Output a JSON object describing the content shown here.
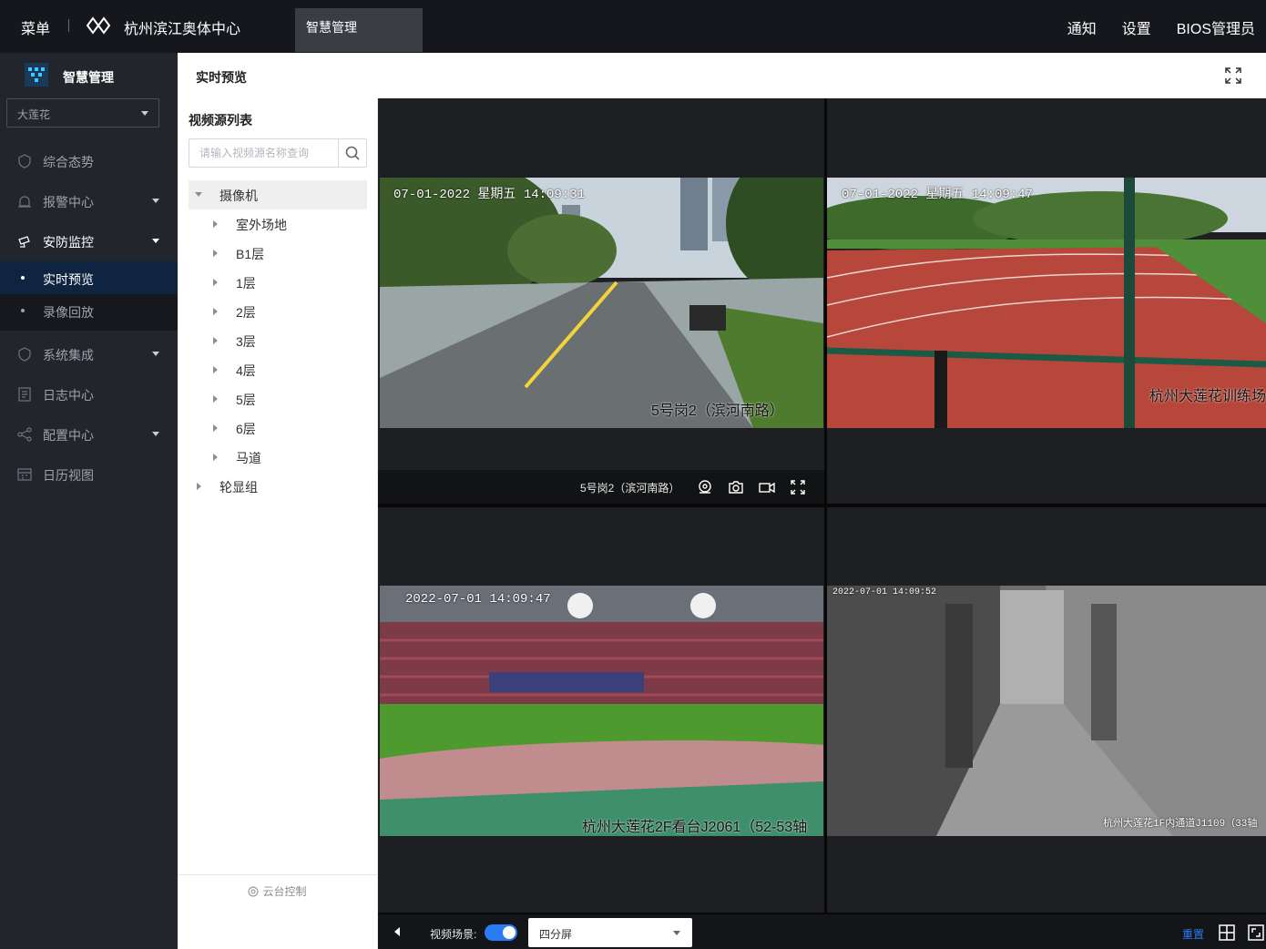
{
  "topbar": {
    "menu": "菜单",
    "app_title": "杭州滨江奥体中心",
    "active_tab": "智慧管理",
    "right": {
      "notify": "通知",
      "settings": "设置",
      "user": "BIOS管理员"
    }
  },
  "sidebar": {
    "title": "智慧管理",
    "venue": "大莲花",
    "items": [
      {
        "label": "综合态势",
        "icon": "shield-icon"
      },
      {
        "label": "报警中心",
        "icon": "alarm-icon"
      },
      {
        "label": "安防监控",
        "icon": "camera-icon"
      },
      {
        "label": "系统集成",
        "icon": "shield-icon"
      },
      {
        "label": "日志中心",
        "icon": "log-icon"
      },
      {
        "label": "配置中心",
        "icon": "share-icon"
      },
      {
        "label": "日历视图",
        "icon": "calendar-icon"
      }
    ],
    "subitems": [
      {
        "label": "实时预览"
      },
      {
        "label": "录像回放"
      }
    ]
  },
  "header": {
    "title": "实时预览"
  },
  "tree": {
    "title": "视频源列表",
    "search_placeholder": "请输入视频源名称查询",
    "root": "摄像机",
    "children": [
      "室外场地",
      "B1层",
      "1层",
      "2层",
      "3层",
      "4层",
      "5层",
      "6层",
      "马道"
    ],
    "group": "轮显组",
    "ptz": "云台控制"
  },
  "cells": [
    {
      "osd": "07-01-2022 星期五 14:09:31",
      "label": "5号岗2（滨河南路）",
      "toolbar_name": "5号岗2（滨河南路）"
    },
    {
      "osd": "07-01-2022 星期五 14:09:47",
      "label": "杭州大莲花训练场"
    },
    {
      "osd": "2022-07-01 14:09:47",
      "label": "杭州大莲花2F看台J2061（52-53轴"
    },
    {
      "osd": "2022-07-01 14:09:52",
      "label": "杭州大莲花1F内通道J1109（33轴"
    }
  ],
  "bottom": {
    "scene_label": "视频场景:",
    "layout": "四分屏",
    "reset": "重置"
  }
}
